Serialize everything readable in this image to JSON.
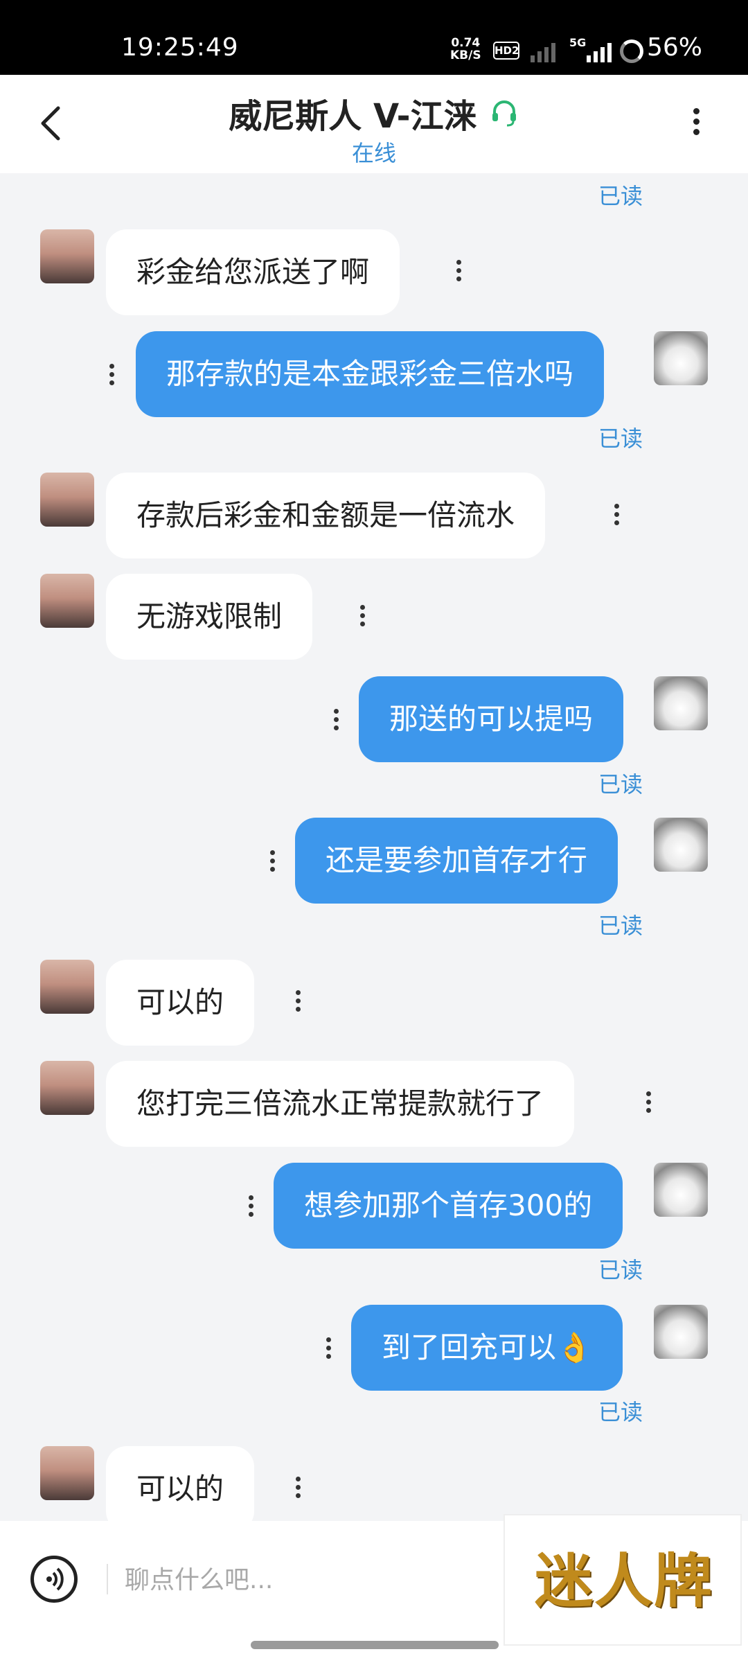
{
  "status_bar": {
    "time": "19:25:49",
    "speed_value": "0.74",
    "speed_unit": "KB/S",
    "hd_label": "HD2",
    "network_label": "5G",
    "battery": "56%"
  },
  "header": {
    "title": "威尼斯人 V-江涞",
    "status": "在线"
  },
  "chat": {
    "read_label": "已读",
    "messages": [
      {
        "side": "in",
        "text": "彩金给您派送了啊"
      },
      {
        "side": "out",
        "text": "那存款的是本金跟彩金三倍水吗"
      },
      {
        "side": "in",
        "text": "存款后彩金和金额是一倍流水"
      },
      {
        "side": "in",
        "text": "无游戏限制"
      },
      {
        "side": "out",
        "text": "那送的可以提吗"
      },
      {
        "side": "out",
        "text": "还是要参加首存才行"
      },
      {
        "side": "in",
        "text": "可以的"
      },
      {
        "side": "in",
        "text": "您打完三倍流水正常提款就行了"
      },
      {
        "side": "out",
        "text": "想参加那个首存300的"
      },
      {
        "side": "out",
        "text": "到了回充可以👌"
      },
      {
        "side": "in",
        "text": "可以的"
      }
    ]
  },
  "input_bar": {
    "placeholder": "聊点什么吧..."
  },
  "watermark": {
    "text": "迷人牌"
  },
  "colors": {
    "accent": "#3d97ec",
    "online": "#3a8fd6",
    "headset": "#2bb673"
  }
}
